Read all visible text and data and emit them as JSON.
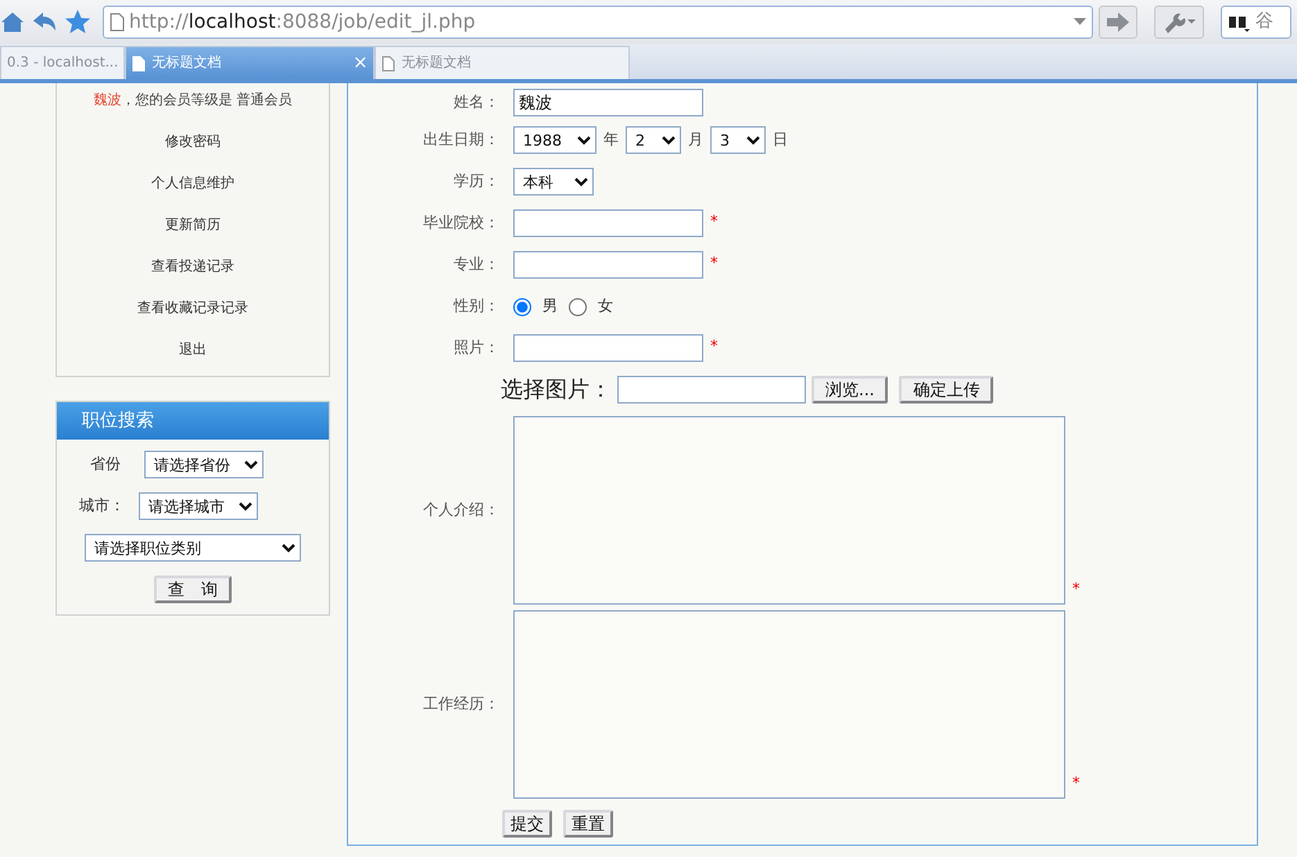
{
  "browser": {
    "address": "http://**localhost**:8088/job/edit_jl.php",
    "search_text": "谷",
    "tabs": [
      {
        "label": "0.3 - localhost...",
        "selected": false
      },
      {
        "label": "无标题文档",
        "selected": true,
        "close": "×"
      },
      {
        "label": "无标题文档",
        "selected": false
      }
    ]
  },
  "sidebar": {
    "user": {
      "name": "魏波",
      "greeting": "，您的会员等级是 普通会员"
    },
    "menu": [
      "修改密码",
      "个人信息维护",
      "更新简历",
      "查看投递记录",
      "查看收藏记录记录",
      "退出"
    ],
    "search": {
      "title": "职位搜索",
      "province_label": "省份",
      "province": "请选择省份",
      "city_label": "城市：",
      "city": "请选择城市",
      "category": "请选择职位类别",
      "button": "查　询"
    }
  },
  "form": {
    "fields": [
      {
        "kind": "text",
        "label": "姓名：",
        "value": "魏波"
      },
      {
        "kind": "date",
        "label": "出生日期：",
        "parts": [
          {
            "value": "1988",
            "unit": "年"
          },
          {
            "value": "2",
            "unit": "月"
          },
          {
            "value": "3",
            "unit": "日"
          }
        ]
      },
      {
        "kind": "select",
        "label": "学历：",
        "value": "本科"
      },
      {
        "kind": "text",
        "label": "毕业院校：",
        "note": "*"
      },
      {
        "kind": "text",
        "label": "专业：",
        "note": "*"
      },
      {
        "kind": "radio",
        "label": "性别：",
        "options": [
          {
            "label": "男",
            "selected": true
          },
          {
            "label": "女",
            "selected": false
          }
        ]
      },
      {
        "kind": "text",
        "label": "照片：",
        "note": "*"
      },
      {
        "kind": "file",
        "label": "选择图片：",
        "browse": "浏览...",
        "upload": "确定上传"
      },
      {
        "kind": "textarea",
        "label": "个人介绍：",
        "note": "*"
      },
      {
        "kind": "textarea",
        "label": "工作经历：",
        "note": "*"
      }
    ],
    "buttons": [
      "提交",
      "重置"
    ]
  }
}
